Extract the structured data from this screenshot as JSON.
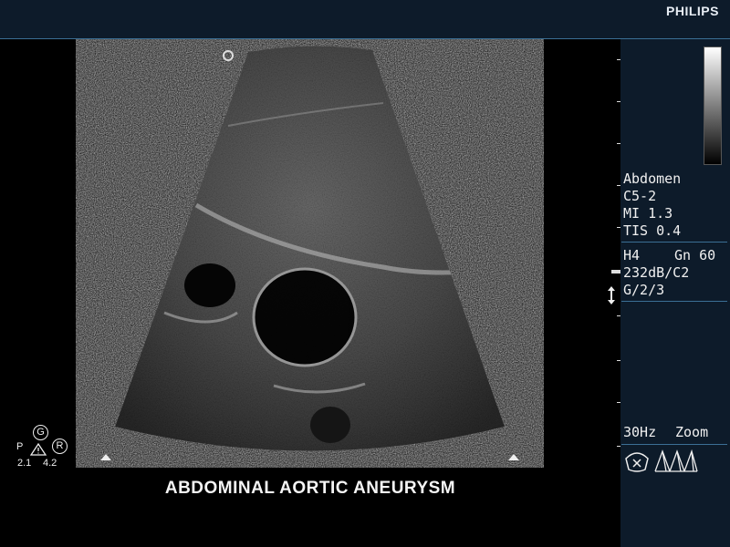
{
  "brand": "PHILIPS",
  "preset": {
    "exam": "Abdomen",
    "probe": "C5-2",
    "mi": "MI 1.3",
    "tis": "TIS 0.4"
  },
  "settings": {
    "harmonic": "H4",
    "gain": "Gn 60",
    "dynamic_range": "232dB/C2",
    "gray_map": "G/2/3"
  },
  "frame_rate": "30Hz",
  "mode": "Zoom",
  "caption": "ABDOMINAL AORTIC ANEURYSM",
  "indicator": {
    "p_label": "P",
    "g_label": "G",
    "r_label": "R",
    "left_value": "2.1",
    "right_value": "4.2"
  },
  "icons": [
    "orientation-marker-icon",
    "focus-marker-icon",
    "depth-adjust-icon",
    "probe-icon",
    "mode-icon"
  ],
  "colors": {
    "panel": "#0d1b2a",
    "accent_line": "#3b6f95",
    "image_bg": "#000000"
  }
}
